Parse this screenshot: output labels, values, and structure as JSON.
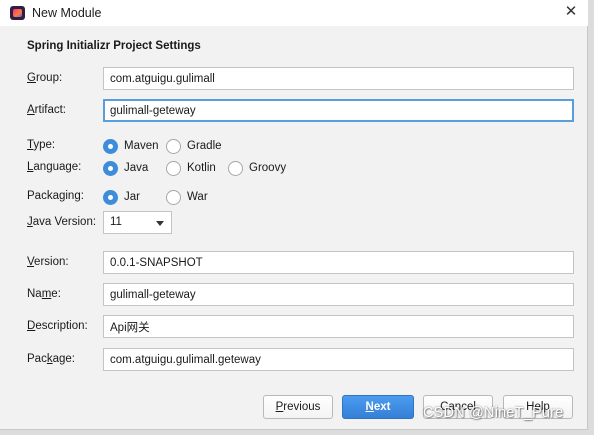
{
  "window": {
    "title": "New Module",
    "close_glyph": "✕"
  },
  "section_title": "Spring Initializr Project Settings",
  "fields": {
    "group": {
      "mn": "G",
      "rest": "roup:",
      "value": "com.atguigu.gulimall"
    },
    "artifact": {
      "mn": "A",
      "rest": "rtifact:",
      "value": "gulimall-geteway"
    },
    "version": {
      "mn": "V",
      "rest": "ersion:",
      "value": "0.0.1-SNAPSHOT"
    },
    "name": {
      "pre": "Na",
      "mn": "m",
      "rest": "e:",
      "value": "gulimall-geteway"
    },
    "description": {
      "mn": "D",
      "rest": "escription:",
      "value": "Api网关"
    },
    "package": {
      "pre": "Pac",
      "mn": "k",
      "rest": "age:",
      "value": "com.atguigu.gulimall.geteway"
    }
  },
  "type": {
    "mn": "T",
    "rest": "ype:",
    "options": [
      "Maven",
      "Gradle"
    ],
    "selected": "Maven"
  },
  "language": {
    "mn": "L",
    "rest": "anguage:",
    "options": [
      "Java",
      "Kotlin",
      "Groovy"
    ],
    "selected": "Java"
  },
  "packaging": {
    "pre": "Packa",
    "mn": "g",
    "rest": "ing:",
    "options": [
      "Jar",
      "War"
    ],
    "selected": "Jar"
  },
  "java_version": {
    "mn": "J",
    "rest": "ava Version:",
    "value": "11"
  },
  "buttons": {
    "previous": {
      "mn": "P",
      "rest": "revious"
    },
    "next": {
      "mn": "N",
      "rest": "ext"
    },
    "cancel": "Cancel",
    "help": "Help"
  },
  "watermark": "CSDN @NineT_Pure",
  "colors": {
    "accent": "#3d8ddb",
    "focus_border": "#5a9fdc",
    "primary_button": "#3580d6"
  }
}
